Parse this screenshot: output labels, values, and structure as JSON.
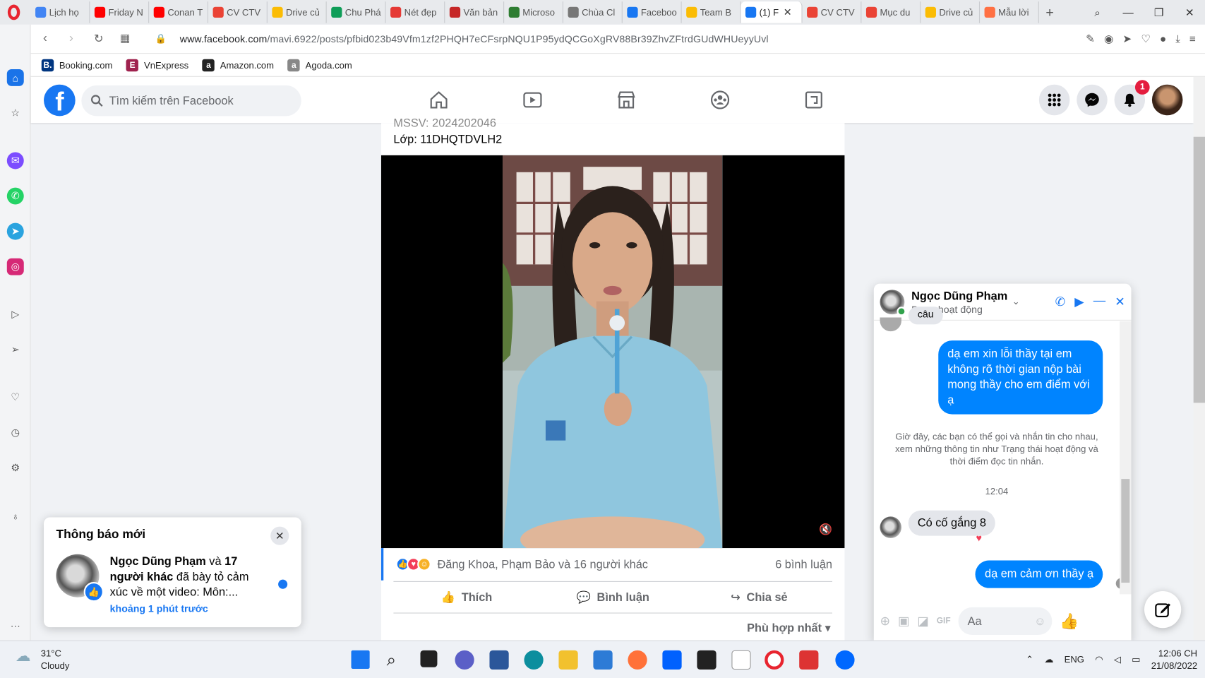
{
  "browser": {
    "tabs": [
      {
        "label": "Lịch họ",
        "color": "#4285f4"
      },
      {
        "label": "Friday N",
        "color": "#ff0000"
      },
      {
        "label": "Conan T",
        "color": "#ff0000"
      },
      {
        "label": "CV CTV",
        "color": "#ea4335"
      },
      {
        "label": "Drive củ",
        "color": "#fbbc04"
      },
      {
        "label": "Chu Phá",
        "color": "#0f9d58"
      },
      {
        "label": "Nét đẹp",
        "color": "#e53935"
      },
      {
        "label": "Văn bản",
        "color": "#c62828"
      },
      {
        "label": "Microso",
        "color": "#2e7d32"
      },
      {
        "label": "Chùa Cl",
        "color": "#777777"
      },
      {
        "label": "Faceboo",
        "color": "#1877f2"
      },
      {
        "label": "Team B",
        "color": "#fbbc04"
      },
      {
        "label": "(1) F",
        "color": "#1877f2"
      },
      {
        "label": "CV CTV",
        "color": "#ea4335"
      },
      {
        "label": "Mục du",
        "color": "#ea4335"
      },
      {
        "label": "Drive củ",
        "color": "#fbbc04"
      },
      {
        "label": "Mẫu lời",
        "color": "#ff7043"
      }
    ],
    "url_domain": "www.facebook.com",
    "url_path": "/mavi.6922/posts/pfbid023b49Vfm1zf2PHQH7eCFsrpNQU1P95ydQCGoXgRV88Br39ZhvZFtrdGUdWHUeyyUvl",
    "bookmarks": [
      {
        "icon": "B.",
        "label": "Booking.com",
        "color": "#003580"
      },
      {
        "icon": "E",
        "label": "VnExpress",
        "color": "#9f224e"
      },
      {
        "icon": "a",
        "label": "Amazon.com",
        "color": "#222222"
      },
      {
        "icon": "a",
        "label": "Agoda.com",
        "color": "#888888"
      }
    ]
  },
  "facebook": {
    "logo": "f",
    "search_placeholder": "Tìm kiếm trên Facebook",
    "notification_count": "1"
  },
  "post": {
    "line1": "MSSV: 2024202046",
    "line2": "Lớp: 11DHQTDVLH2",
    "reactions_text": "Đăng Khoa, Phạm Bảo và 16 người khác",
    "comments_count": "6 bình luận",
    "like_label": "Thích",
    "comment_label": "Bình luận",
    "share_label": "Chia sẻ",
    "sort_label": "Phù hợp nhất"
  },
  "notification": {
    "title": "Thông báo mới",
    "user": "Ngọc Dũng Phạm",
    "connector": " và ",
    "others": "17 người khác",
    "action": " đã bày tỏ cảm xúc về một video: Môn:...",
    "time": "khoảng 1 phút trước"
  },
  "chat": {
    "name": "Ngọc Dũng Phạm",
    "status": "Đang hoạt động",
    "partial_msg": "câu",
    "msg_out_1": "dạ em xin lỗi thầy tại em không rõ thời gian nộp bài mong thầy cho em điểm với ạ",
    "system_text": "Giờ đây, các bạn có thể gọi và nhắn tin cho nhau, xem những thông tin như Trạng thái hoạt động và thời điểm đọc tin nhắn.",
    "time": "12:04",
    "msg_in_1": "Có cố gắng 8",
    "msg_out_2": "dạ em cảm ơn thầy ạ",
    "input_placeholder": "Aa"
  },
  "taskbar": {
    "temperature": "31°C",
    "weather": "Cloudy",
    "language": "ENG",
    "time": "12:06 CH",
    "date": "21/08/2022"
  }
}
